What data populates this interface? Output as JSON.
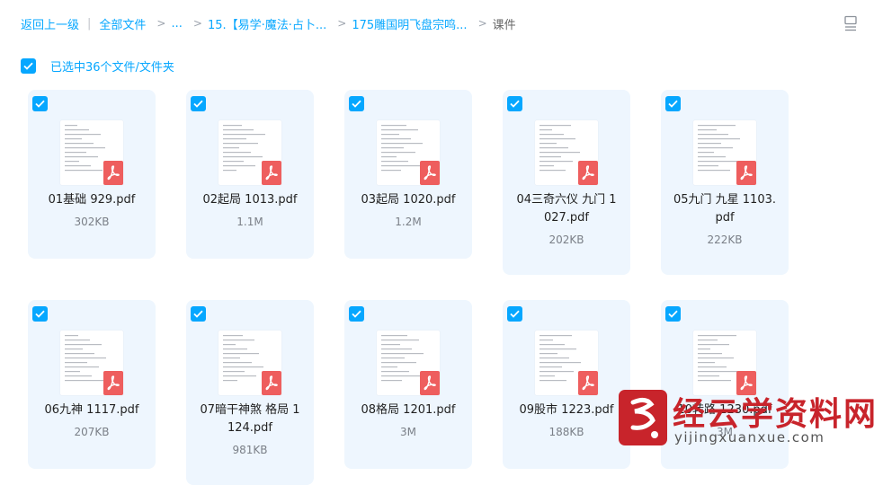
{
  "breadcrumb": {
    "back": "返回上一级",
    "all_files": "全部文件",
    "ellipsis": "...",
    "level1": "15.【易学·魔法·占卜...",
    "level2": "175雕国明飞盘宗鸣...",
    "current": "课件"
  },
  "selection": {
    "text": "已选中36个文件/文件夹"
  },
  "files": [
    {
      "name_lines": [
        "01基础 929.pdf"
      ],
      "size": "302KB"
    },
    {
      "name_lines": [
        "02起局 1013.pdf"
      ],
      "size": "1.1M"
    },
    {
      "name_lines": [
        "03起局 1020.pdf"
      ],
      "size": "1.2M"
    },
    {
      "name_lines": [
        "04三奇六仪 九门 1",
        "027.pdf"
      ],
      "size": "202KB"
    },
    {
      "name_lines": [
        "05九门 九星 1103.",
        "pdf"
      ],
      "size": "222KB"
    },
    {
      "name_lines": [
        "06九神 1117.pdf"
      ],
      "size": "207KB"
    },
    {
      "name_lines": [
        "07暗干神煞 格局 1",
        "124.pdf"
      ],
      "size": "981KB"
    },
    {
      "name_lines": [
        "08格局 1201.pdf"
      ],
      "size": "3M"
    },
    {
      "name_lines": [
        "09股市 1223.pdf"
      ],
      "size": "188KB"
    },
    {
      "name_lines": [
        "10转路 1230.pdf"
      ],
      "size": "3M"
    }
  ],
  "watermark": {
    "title": "经云学资料网",
    "url": "yijingxuanxue.com"
  },
  "colors": {
    "accent": "#06a7ff",
    "card_bg": "#eef6fe",
    "pdf_red": "#ee5e5e",
    "watermark_red": "#c8242b"
  },
  "icons": {
    "view_toggle": "list-view-icon",
    "checkbox": "checkmark-icon",
    "file": "pdf-icon"
  }
}
